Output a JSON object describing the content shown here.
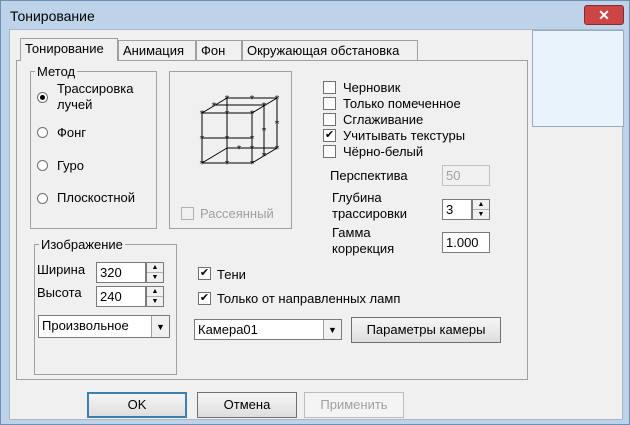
{
  "window": {
    "title": "Тонирование",
    "close_glyph": "✕"
  },
  "tabs": [
    {
      "label": "Тонирование",
      "active": true
    },
    {
      "label": "Анимация",
      "active": false
    },
    {
      "label": "Фон",
      "active": false
    },
    {
      "label": "Окружающая обстановка",
      "active": false
    }
  ],
  "method": {
    "legend": "Метод",
    "options": [
      {
        "label_line1": "Трассировка",
        "label_line2": "лучей",
        "selected": true
      },
      {
        "label": "Фонг",
        "selected": false
      },
      {
        "label": "Гуро",
        "selected": false
      },
      {
        "label": "Плоскостной",
        "selected": false
      }
    ]
  },
  "diffuse": {
    "label": "Рассеянный",
    "checked": false,
    "enabled": false
  },
  "options": [
    {
      "label": "Черновик",
      "checked": false
    },
    {
      "label": "Только помеченное",
      "checked": false
    },
    {
      "label": "Сглаживание",
      "checked": false
    },
    {
      "label": "Учитывать текстуры",
      "checked": true
    },
    {
      "label": "Чёрно-белый",
      "checked": false
    }
  ],
  "check_mark": "✔",
  "perspective": {
    "label": "Перспектива",
    "value": "50"
  },
  "depth": {
    "label_line1": "Глубина",
    "label_line2": "трассировки",
    "value": "3"
  },
  "gamma": {
    "label_line1": "Гамма",
    "label_line2": "коррекция",
    "value": "1.000"
  },
  "image": {
    "legend": "Изображение",
    "width_label": "Ширина",
    "width_value": "320",
    "height_label": "Высота",
    "height_value": "240",
    "size_preset": "Произвольное"
  },
  "shadows": {
    "label": "Тени",
    "checked": true
  },
  "directional_only": {
    "label": "Только от направленных ламп",
    "checked": true
  },
  "camera": {
    "value": "Камера01",
    "params_label": "Параметры камеры"
  },
  "footer": {
    "ok": "OK",
    "cancel": "Отмена",
    "apply": "Применить"
  },
  "arrow_glyph": "▼",
  "spin_up": "▲",
  "spin_down": "▼"
}
